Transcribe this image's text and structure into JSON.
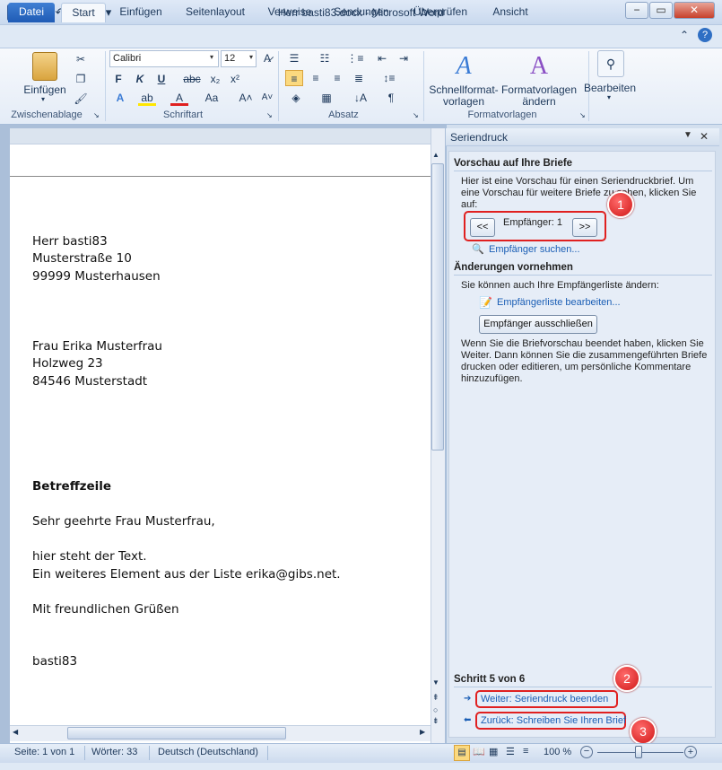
{
  "window": {
    "title": "Herr basti83.docx - Microsoft Word",
    "app_icon": "W",
    "minimize_label": "−",
    "restore_label": "▭",
    "close_label": "✕"
  },
  "quick_access": {
    "save_icon": "💾",
    "undo_icon": "↶",
    "redo_icon": "↻",
    "customize_icon": "▾"
  },
  "tabs": [
    {
      "label": "Datei"
    },
    {
      "label": "Start"
    },
    {
      "label": "Einfügen"
    },
    {
      "label": "Seitenlayout"
    },
    {
      "label": "Verweise"
    },
    {
      "label": "Sendungen"
    },
    {
      "label": "Überprüfen"
    },
    {
      "label": "Ansicht"
    }
  ],
  "ribbon": {
    "paste_label": "Einfügen",
    "font_name": "Calibri",
    "font_size": "12",
    "quickstyles_label": "Schnellformat-",
    "quickstyles_label2": "vorlagen",
    "change_styles_label": "Formatvorlagen",
    "change_styles_label2": "ändern",
    "edit_label": "Bearbeiten",
    "groups": {
      "clipboard": "Zwischenablage",
      "font": "Schriftart",
      "paragraph": "Absatz",
      "styles": "Formatvorlagen"
    }
  },
  "document": {
    "sender": [
      "Herr basti83",
      "Musterstraße 10",
      "99999 Musterhausen"
    ],
    "recipient": [
      "Frau Erika Musterfrau",
      "Holzweg 23",
      "84546 Musterstadt"
    ],
    "subject": "Betreffzeile",
    "salutation": "Sehr geehrte Frau Musterfrau,",
    "body1": "hier steht der Text.",
    "body2": "Ein weiteres Element aus der Liste erika@gibs.net.",
    "closing": "Mit freundlichen Grüßen",
    "signature": "basti83"
  },
  "pane": {
    "title": "Seriendruck",
    "preview_heading": "Vorschau auf Ihre Briefe",
    "preview_text": "Hier ist eine Vorschau für einen Seriendruckbrief. Um eine Vorschau für weitere Briefe zu sehen, klicken Sie auf:",
    "prev_label": "<<",
    "next_label": ">>",
    "recipient_label": "Empfänger: 1",
    "find_recipient": "Empfänger suchen...",
    "changes_heading": "Änderungen vornehmen",
    "changes_text": "Sie können auch Ihre Empfängerliste ändern:",
    "edit_list": "Empfängerliste bearbeiten...",
    "exclude_label": "Empfänger ausschließen",
    "finish_text": "Wenn Sie die Briefvorschau beendet haben, klicken Sie Weiter. Dann können Sie die zusammengeführten Briefe drucken oder editieren, um persönliche Kommentare hinzuzufügen.",
    "step": "Schritt 5 von 6",
    "next_step": "Weiter: Seriendruck beenden",
    "prev_step": "Zurück: Schreiben Sie Ihren Brief"
  },
  "badges": [
    "1",
    "2",
    "3"
  ],
  "status": {
    "page": "Seite: 1 von 1",
    "words": "Wörter: 33",
    "language": "Deutsch (Deutschland)",
    "zoom": "100 %"
  }
}
